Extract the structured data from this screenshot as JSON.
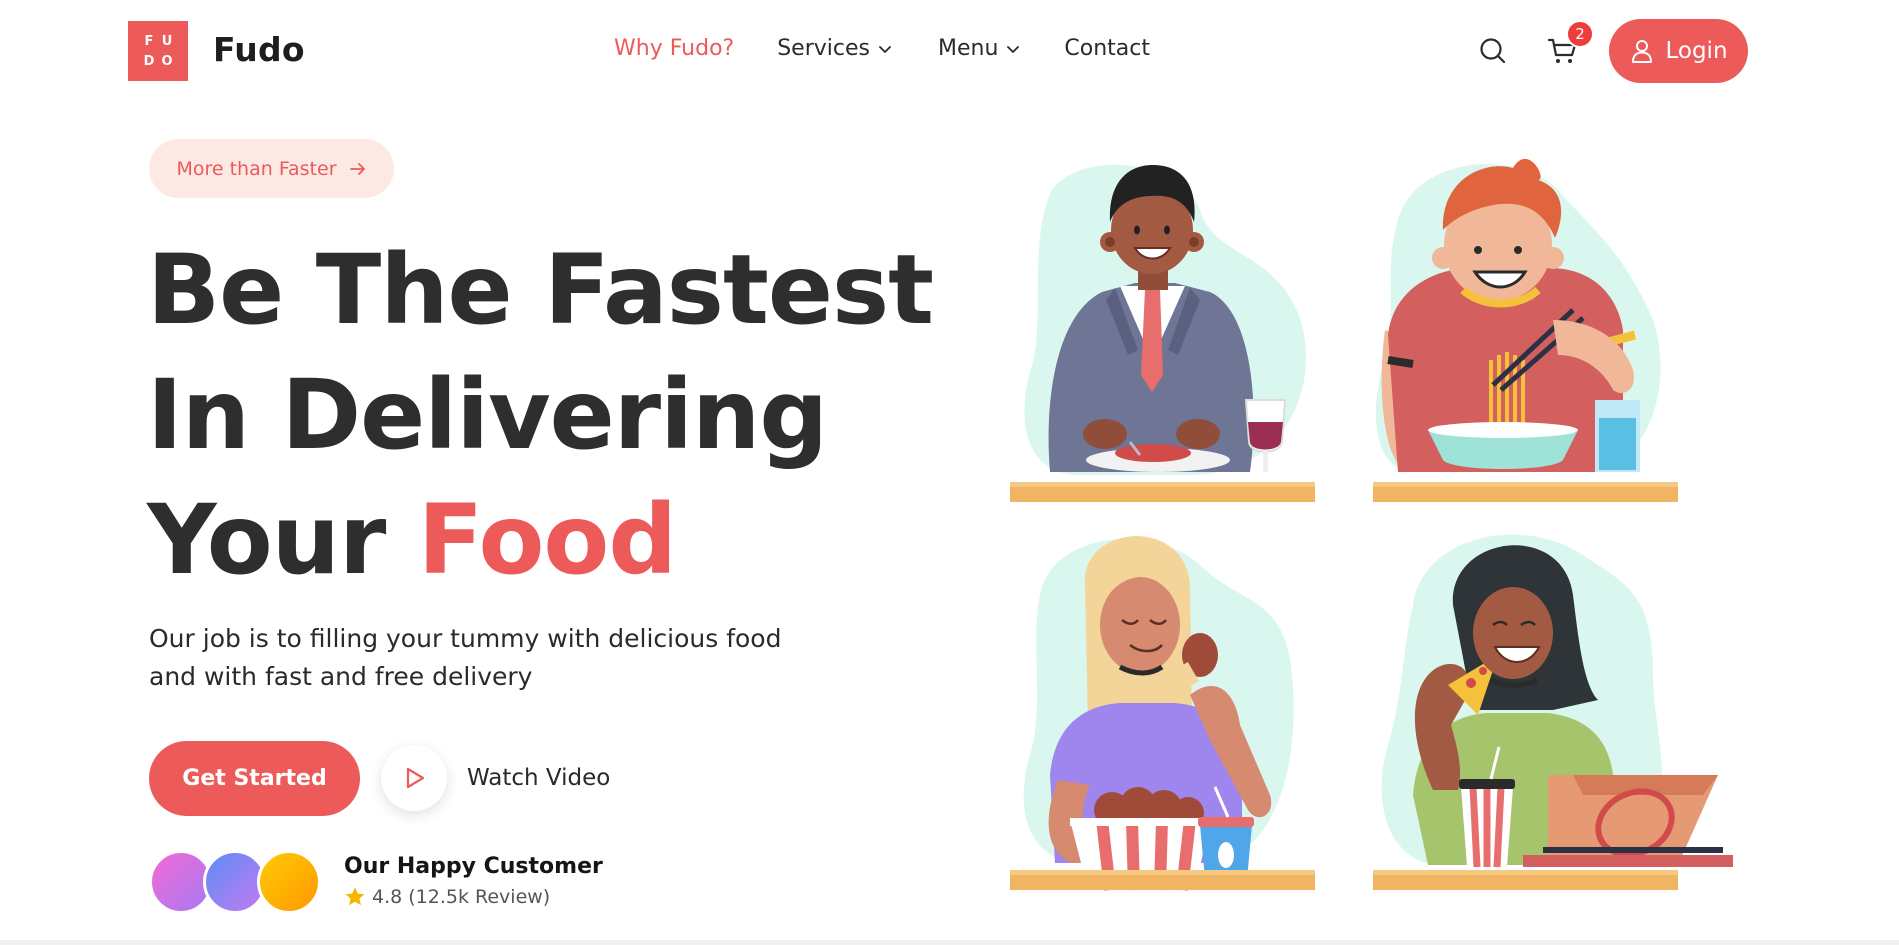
{
  "brand": {
    "logo_letters": [
      "F",
      "U",
      "D",
      "O"
    ],
    "name": "Fudo",
    "accent_color": "#ec5a5a"
  },
  "nav": {
    "items": [
      {
        "label": "Why Fudo?",
        "active": true
      },
      {
        "label": "Services",
        "has_dropdown": true
      },
      {
        "label": "Menu",
        "has_dropdown": true
      },
      {
        "label": "Contact"
      }
    ]
  },
  "header": {
    "search_icon": "search-icon",
    "cart_icon": "cart-icon",
    "cart_count": "2",
    "login_label": "Login",
    "login_icon": "user-icon"
  },
  "hero": {
    "pill_label": "More than Faster",
    "title_line1": "Be The Fastest",
    "title_line2": "In Delivering",
    "title_line3_prefix": "Your ",
    "title_line3_accent": "Food",
    "description": "Our job is to filling your tummy with delicious food and with fast and free delivery",
    "cta_label": "Get Started",
    "watch_label": "Watch Video"
  },
  "customers": {
    "title": "Our Happy Customer",
    "rating": "4.8 (12.5k Review)",
    "avatar_count": 3
  },
  "illustrations": [
    {
      "name": "man-in-suit-eating-steak"
    },
    {
      "name": "boy-eating-noodles"
    },
    {
      "name": "woman-eating-chicken"
    },
    {
      "name": "woman-eating-pizza"
    }
  ],
  "colors": {
    "primary": "#ec5a5a",
    "pill_bg": "#fde9e3",
    "blob": "#d9f7ee",
    "table": "#f0b462",
    "badge": "#ee3b3b"
  }
}
